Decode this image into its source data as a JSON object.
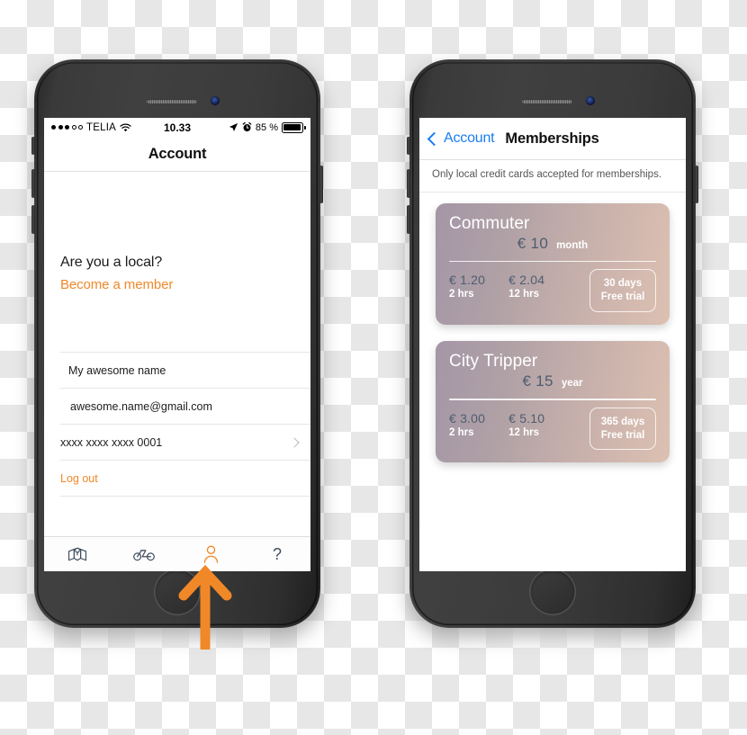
{
  "left_phone": {
    "status_bar": {
      "signal_dots": [
        true,
        true,
        true,
        false,
        false
      ],
      "carrier": "TELIA",
      "wifi_icon": "wifi-icon",
      "time": "10.33",
      "location_icon": "location-arrow-icon",
      "alarm_icon": "alarm-clock-icon",
      "battery_percent": "85 %",
      "battery_level": 85
    },
    "nav": {
      "title": "Account"
    },
    "promo": {
      "question": "Are you a local?",
      "cta": "Become a member"
    },
    "list": [
      {
        "name": "name-row",
        "value": "My awesome name"
      },
      {
        "name": "email-row",
        "value": "awesome.name@gmail.com"
      },
      {
        "name": "card-row",
        "value": "xxxx xxxx xxxx 0001",
        "chevron": true
      },
      {
        "name": "logout-row",
        "value": "Log out",
        "accent": true
      }
    ],
    "tabbar": [
      {
        "icon": "map-pin-icon",
        "active": false
      },
      {
        "icon": "bicycle-icon",
        "active": false
      },
      {
        "icon": "person-icon",
        "active": true
      },
      {
        "icon": "question-mark-icon",
        "active": false
      }
    ]
  },
  "right_phone": {
    "nav": {
      "back_label": "Account",
      "back_icon": "chevron-left-icon",
      "title": "Memberships"
    },
    "notice": "Only local credit cards accepted for memberships.",
    "cards": [
      {
        "title": "Commuter",
        "price": "€ 10",
        "period": "month",
        "rates": [
          {
            "amount": "€ 1.20",
            "duration": "2 hrs"
          },
          {
            "amount": "€ 2.04",
            "duration": "12 hrs"
          }
        ],
        "trial_days": "30 days",
        "trial_label": "Free trial"
      },
      {
        "title": "City Tripper",
        "price": "€ 15",
        "period": "year",
        "rates": [
          {
            "amount": "€ 3.00",
            "duration": "2 hrs"
          },
          {
            "amount": "€ 5.10",
            "duration": "12 hrs"
          }
        ],
        "trial_days": "365 days",
        "trial_label": "Free trial"
      }
    ]
  },
  "annotation": {
    "arrow_icon": "up-arrow-annotation",
    "color": "#f08828"
  },
  "colors": {
    "accent_orange": "#f08828",
    "link_blue": "#1a7df0",
    "card_gradient_start": "#a496a6",
    "card_gradient_end": "#dcc0b2",
    "price_blue_gray": "#4e5d70",
    "tab_icon": "#3f4e5e"
  }
}
